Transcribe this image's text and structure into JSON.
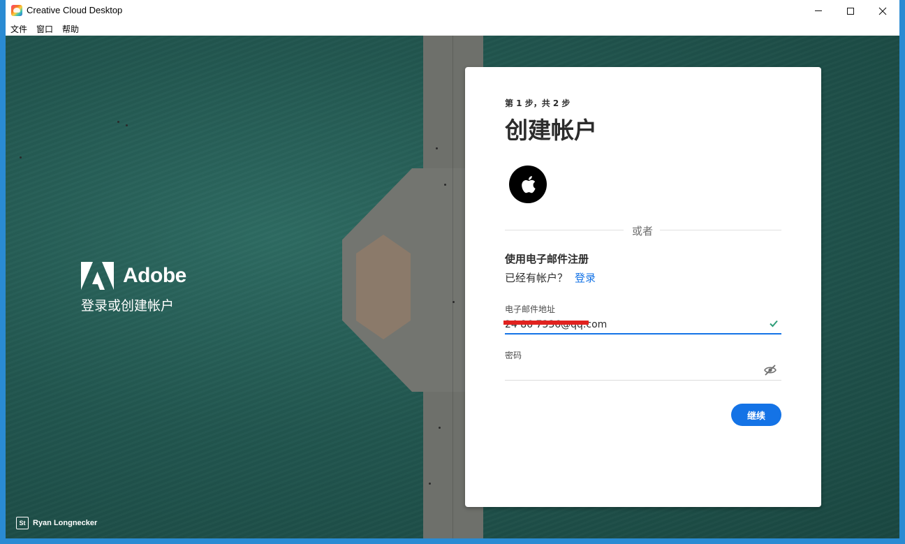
{
  "window": {
    "title": "Creative Cloud Desktop",
    "controls": [
      "minimize-icon",
      "maximize-icon",
      "close-icon"
    ]
  },
  "menu": {
    "items": [
      "文件",
      "窗口",
      "帮助"
    ]
  },
  "branding": {
    "logo_word": "Adobe",
    "subtitle": "登录或创建帐户",
    "photo_credit_badge": "St",
    "photo_credit": "Ryan Longnecker"
  },
  "form": {
    "step": "第 1 步，共 2 步",
    "title": "创建帐户",
    "social_icon": "apple-icon",
    "divider_text": "或者",
    "email_heading": "使用电子邮件注册",
    "have_account": "已经有帐户？",
    "signin_link": "登录",
    "email_label": "电子邮件地址",
    "email_value": "24 86 7336@qq.com",
    "password_label": "密码",
    "password_value": "",
    "continue_label": "继续"
  },
  "colors": {
    "accent": "#1473e6",
    "valid_check": "#2d9d78",
    "redaction": "#e1221f"
  }
}
